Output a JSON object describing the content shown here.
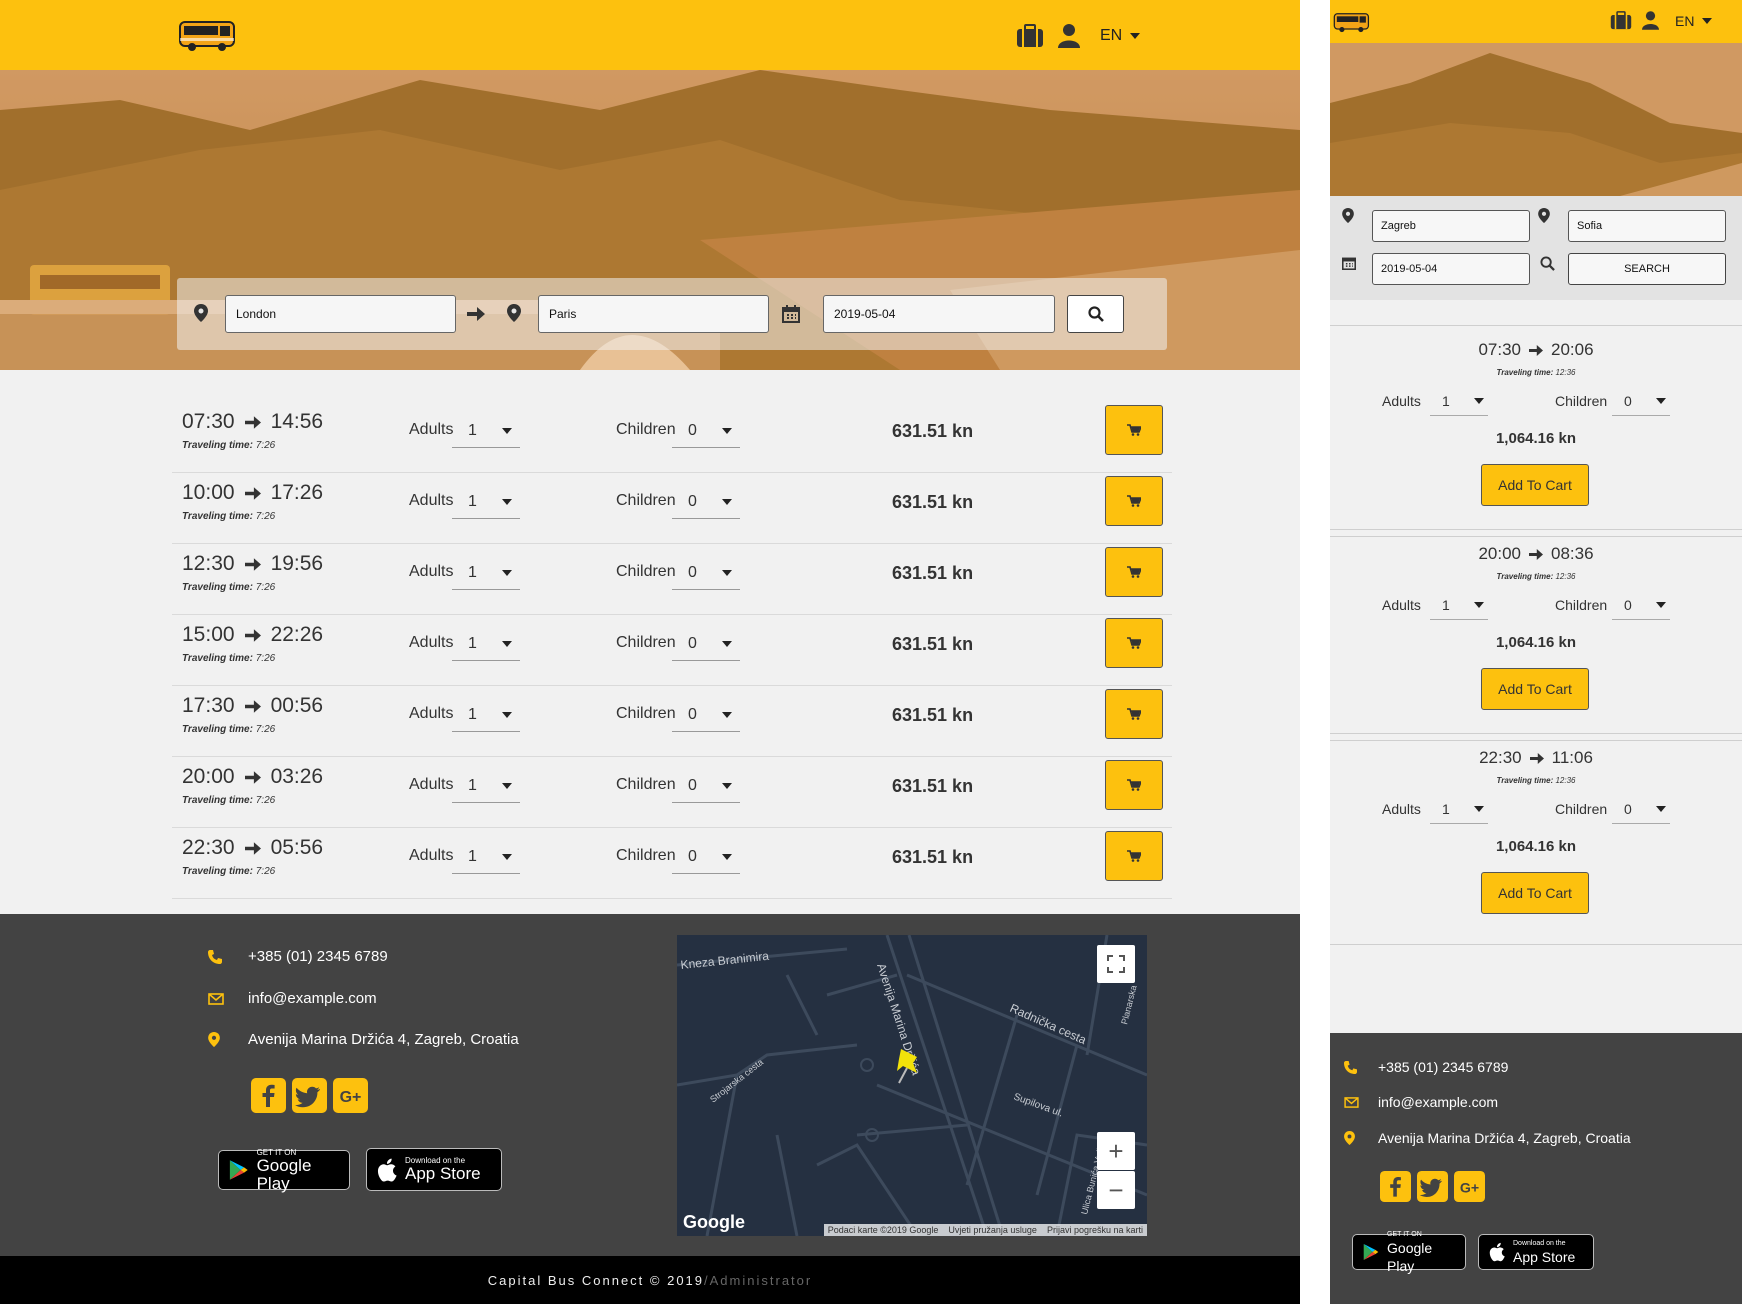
{
  "colors": {
    "accent": "#fdc10e",
    "footer": "#434343",
    "bottom_bar": "#000000",
    "page_bg": "#f1f1f1"
  },
  "header": {
    "logo_icon": "bus-logo-icon",
    "luggage_icon": "suitcase-icon",
    "user_icon": "user-icon",
    "language": "EN"
  },
  "desktop": {
    "search": {
      "from": "London",
      "to": "Paris",
      "date": "2019-05-04"
    },
    "trips": [
      {
        "depart": "07:30",
        "arrive": "14:56",
        "travel_label": "Traveling time:",
        "travel_time": "7:26",
        "adults_label": "Adults",
        "adults": "1",
        "children_label": "Children",
        "children": "0",
        "price": "631.51 kn"
      },
      {
        "depart": "10:00",
        "arrive": "17:26",
        "travel_label": "Traveling time:",
        "travel_time": "7:26",
        "adults_label": "Adults",
        "adults": "1",
        "children_label": "Children",
        "children": "0",
        "price": "631.51 kn"
      },
      {
        "depart": "12:30",
        "arrive": "19:56",
        "travel_label": "Traveling time:",
        "travel_time": "7:26",
        "adults_label": "Adults",
        "adults": "1",
        "children_label": "Children",
        "children": "0",
        "price": "631.51 kn"
      },
      {
        "depart": "15:00",
        "arrive": "22:26",
        "travel_label": "Traveling time:",
        "travel_time": "7:26",
        "adults_label": "Adults",
        "adults": "1",
        "children_label": "Children",
        "children": "0",
        "price": "631.51 kn"
      },
      {
        "depart": "17:30",
        "arrive": "00:56",
        "travel_label": "Traveling time:",
        "travel_time": "7:26",
        "adults_label": "Adults",
        "adults": "1",
        "children_label": "Children",
        "children": "0",
        "price": "631.51 kn"
      },
      {
        "depart": "20:00",
        "arrive": "03:26",
        "travel_label": "Traveling time:",
        "travel_time": "7:26",
        "adults_label": "Adults",
        "adults": "1",
        "children_label": "Children",
        "children": "0",
        "price": "631.51 kn"
      },
      {
        "depart": "22:30",
        "arrive": "05:56",
        "travel_label": "Traveling time:",
        "travel_time": "7:26",
        "adults_label": "Adults",
        "adults": "1",
        "children_label": "Children",
        "children": "0",
        "price": "631.51 kn"
      }
    ]
  },
  "mobile": {
    "search": {
      "from": "Zagreb",
      "to": "Sofia",
      "date": "2019-05-04",
      "button": "SEARCH"
    },
    "trips": [
      {
        "depart": "07:30",
        "arrive": "20:06",
        "travel_label": "Traveling time:",
        "travel_time": "12:36",
        "adults_label": "Adults",
        "adults": "1",
        "children_label": "Children",
        "children": "0",
        "price": "1,064.16 kn",
        "cart_label": "Add To Cart"
      },
      {
        "depart": "20:00",
        "arrive": "08:36",
        "travel_label": "Traveling time:",
        "travel_time": "12:36",
        "adults_label": "Adults",
        "adults": "1",
        "children_label": "Children",
        "children": "0",
        "price": "1,064.16 kn",
        "cart_label": "Add To Cart"
      },
      {
        "depart": "22:30",
        "arrive": "11:06",
        "travel_label": "Traveling time:",
        "travel_time": "12:36",
        "adults_label": "Adults",
        "adults": "1",
        "children_label": "Children",
        "children": "0",
        "price": "1,064.16 kn",
        "cart_label": "Add To Cart"
      }
    ]
  },
  "footer": {
    "phone": "+385 (01) 2345 6789",
    "email": "info@example.com",
    "address": "Avenija Marina Držića 4, Zagreb, Croatia",
    "social_icons": [
      "facebook-icon",
      "twitter-icon",
      "google-plus-icon"
    ],
    "google_play": {
      "small": "GET IT ON",
      "big": "Google Play"
    },
    "app_store": {
      "small": "Download on the",
      "big": "App Store"
    },
    "copyright": "Capital Bus Connect © 2019",
    "separator": "/",
    "admin_link": "Administrator"
  },
  "map": {
    "streets": [
      "Kneza Branimira",
      "Avenija Marina Držića",
      "Radnička cesta",
      "Strojarska cesta",
      "Supilova ul.",
      "Ulica Bunića Vučića",
      "Planarska"
    ],
    "logo": "Google",
    "attribution": [
      "Podaci karte ©2019 Google",
      "Uvjeti pružanja usluge",
      "Prijavi pogrešku na karti"
    ],
    "zoom_in": "+",
    "zoom_out": "−"
  }
}
